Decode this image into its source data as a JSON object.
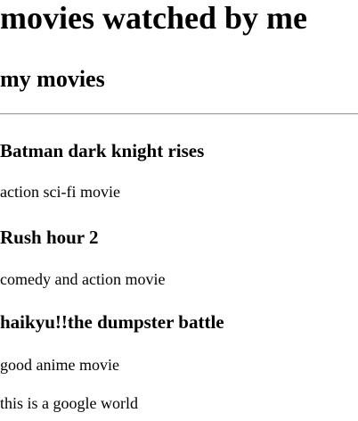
{
  "page": {
    "title": "movies watched by me",
    "subtitle": "my movies"
  },
  "movies": [
    {
      "name": "Batman dark knight rises",
      "description": "action sci-fi movie"
    },
    {
      "name": "Rush hour 2",
      "description": "comedy and action movie"
    },
    {
      "name": "haikyu!!the dumpster battle",
      "description": "good anime movie"
    }
  ],
  "footer": {
    "text": "this is a google world"
  }
}
